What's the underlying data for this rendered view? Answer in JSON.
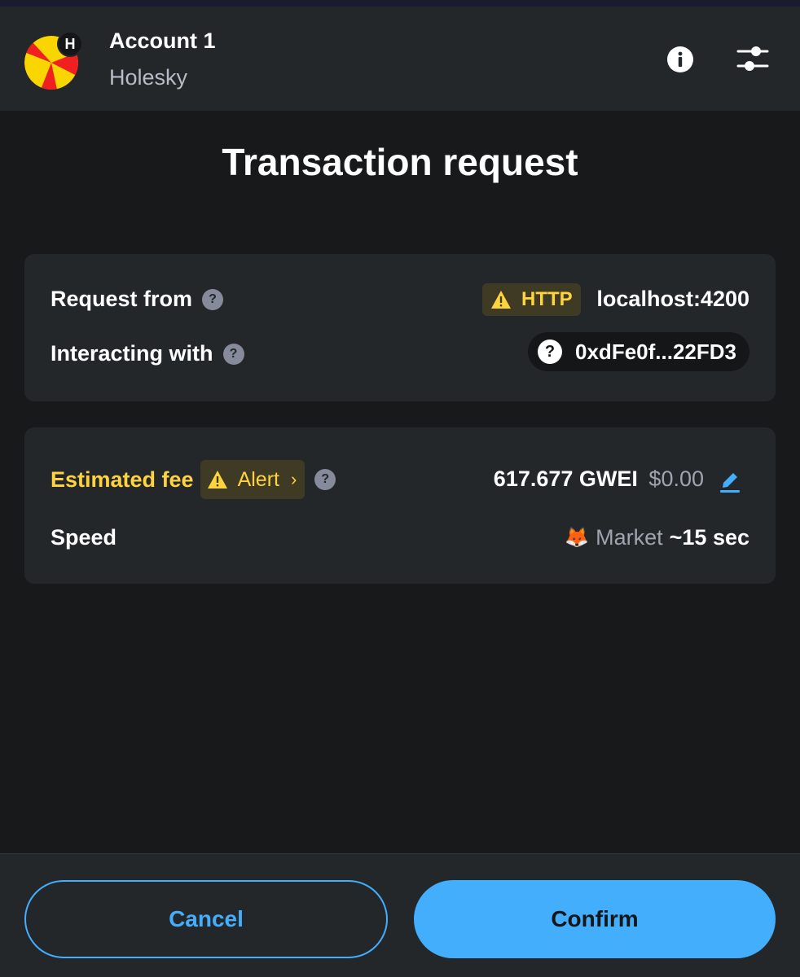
{
  "header": {
    "account_name": "Account 1",
    "network_name": "Holesky",
    "network_badge": "H",
    "avatar_colors": [
      "#f9d600",
      "#f02020"
    ],
    "info_icon": "info-icon",
    "settings_icon": "sliders-icon"
  },
  "title": "Transaction request",
  "request": {
    "request_from_label": "Request from",
    "http_label": "HTTP",
    "origin": "localhost:4200",
    "interacting_label": "Interacting with",
    "address": "0xdFe0f...22FD3"
  },
  "fee": {
    "label": "Estimated fee",
    "alert_label": "Alert",
    "amount": "617.677 GWEI",
    "fiat": "$0.00",
    "speed_label": "Speed",
    "speed_name": "Market",
    "speed_time": "~15 sec"
  },
  "footer": {
    "cancel_label": "Cancel",
    "confirm_label": "Confirm"
  },
  "colors": {
    "accent": "#43aefc",
    "warning": "#ffd33d",
    "background": "#17191b",
    "card": "#24272a"
  }
}
